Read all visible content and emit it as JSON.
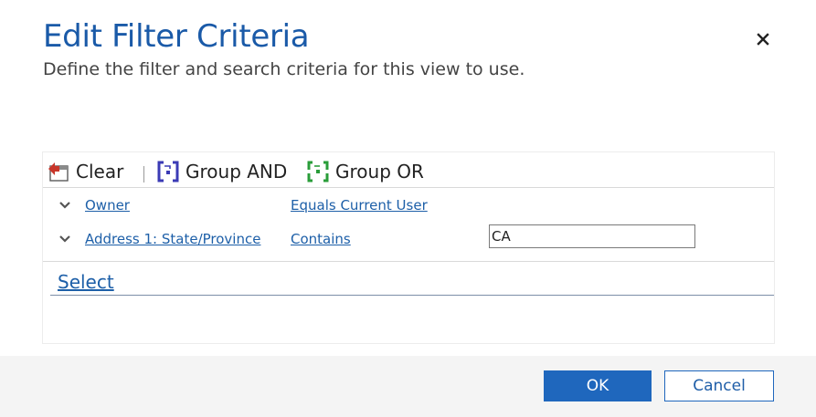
{
  "dialog": {
    "title": "Edit Filter Criteria",
    "subtitle": "Define the filter and search criteria for this view to use.",
    "close_icon": "close-icon"
  },
  "toolbar": {
    "clear_label": "Clear",
    "clear_icon": "clear-filter-icon",
    "group_and_label": "Group AND",
    "group_and_icon": "group-and-icon",
    "group_or_label": "Group OR",
    "group_or_icon": "group-or-icon"
  },
  "criteria": [
    {
      "field": "Owner",
      "operator": "Equals Current User",
      "value": ""
    },
    {
      "field": "Address 1: State/Province",
      "operator": "Contains",
      "value": "CA"
    }
  ],
  "select_label": "Select",
  "footer": {
    "ok_label": "OK",
    "cancel_label": "Cancel"
  },
  "colors": {
    "title": "#1a5aa8",
    "link": "#1d5fa8",
    "primary_button": "#1f67bd",
    "group_and_icon": "#3b3bb5",
    "group_or_icon": "#2a9d3a",
    "clear_icon": "#c8362a"
  }
}
